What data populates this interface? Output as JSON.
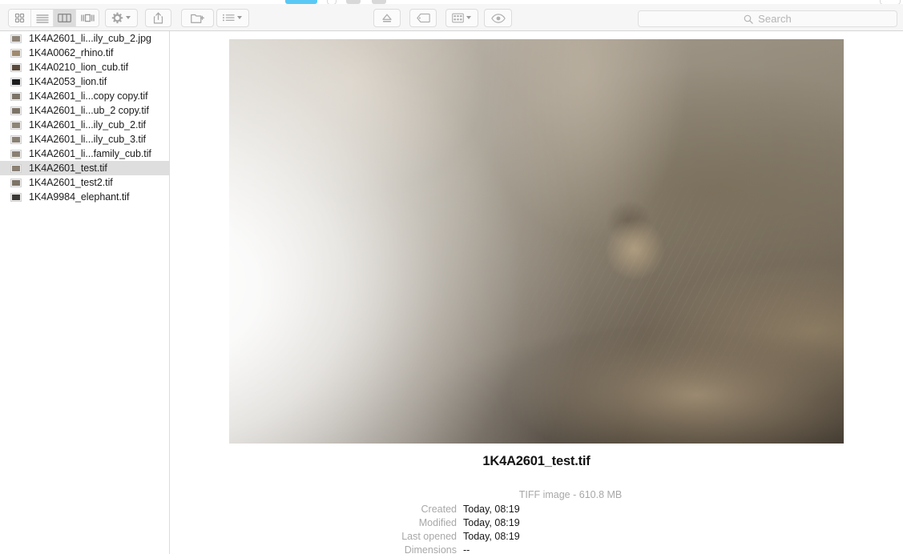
{
  "window": {
    "tabs": [
      {
        "name": "tab-active",
        "state": "active",
        "color": "#5ac8f5"
      },
      {
        "name": "tab-inactive-1",
        "state": "inactive",
        "color": "#d8d8d8"
      },
      {
        "name": "tab-inactive-2",
        "state": "inactive",
        "color": "#d8d8d8"
      },
      {
        "name": "tab-inactive-3",
        "state": "inactive",
        "color": "#d8d8d8"
      }
    ]
  },
  "toolbar": {
    "view_modes": [
      {
        "id": "icon-view",
        "icon": "grid-icon",
        "active": false
      },
      {
        "id": "list-view",
        "icon": "list-icon",
        "active": false
      },
      {
        "id": "column-view",
        "icon": "columns-icon",
        "active": true
      },
      {
        "id": "gallery-view",
        "icon": "gallery-icon",
        "active": false
      }
    ],
    "action_button": {
      "id": "action-menu",
      "icon": "gear-icon",
      "has_chevron": true
    },
    "share_button": {
      "id": "share",
      "icon": "share-icon"
    },
    "new_folder_button": {
      "id": "new-folder",
      "icon": "new-folder-icon"
    },
    "arrange_button": {
      "id": "arrange-menu",
      "icon": "arrange-list-icon",
      "has_chevron": true
    },
    "eject_button": {
      "id": "eject",
      "icon": "eject-icon"
    },
    "tag_button": {
      "id": "tag",
      "icon": "tag-icon"
    },
    "group_button": {
      "id": "group-menu",
      "icon": "group-grid-icon",
      "has_chevron": true
    },
    "quicklook_button": {
      "id": "quick-look",
      "icon": "eye-icon"
    }
  },
  "search": {
    "placeholder": "Search",
    "value": "",
    "icon": "search-icon"
  },
  "file_list": {
    "selected_index": 9,
    "items": [
      {
        "name": "1K4A2601_li...ily_cub_2.jpg",
        "thumb": "#8e8478"
      },
      {
        "name": "1K4A0062_rhino.tif",
        "thumb": "#a08a6e"
      },
      {
        "name": "1K4A0210_lion_cub.tif",
        "thumb": "#5b4a3a"
      },
      {
        "name": "1K4A2053_lion.tif",
        "thumb": "#1d1d1d"
      },
      {
        "name": "1K4A2601_li...copy copy.tif",
        "thumb": "#7d7468"
      },
      {
        "name": "1K4A2601_li...ub_2 copy.tif",
        "thumb": "#7d7468"
      },
      {
        "name": "1K4A2601_li...ily_cub_2.tif",
        "thumb": "#8e8478"
      },
      {
        "name": "1K4A2601_li...ily_cub_3.tif",
        "thumb": "#8a8074"
      },
      {
        "name": "1K4A2601_li...family_cub.tif",
        "thumb": "#8a8074"
      },
      {
        "name": "1K4A2601_test.tif",
        "thumb": "#8a8074"
      },
      {
        "name": "1K4A2601_test2.tif",
        "thumb": "#7d7468"
      },
      {
        "name": "1K4A9984_elephant.tif",
        "thumb": "#3d3a36"
      }
    ]
  },
  "preview": {
    "image_alt": "lion-cub-photo",
    "file_title": "1K4A2601_test.tif",
    "kind_and_size": "TIFF image - 610.8 MB",
    "metadata": [
      {
        "label": "Created",
        "value": "Today, 08:19"
      },
      {
        "label": "Modified",
        "value": "Today, 08:19"
      },
      {
        "label": "Last opened",
        "value": "Today, 08:19"
      },
      {
        "label": "Dimensions",
        "value": "--"
      }
    ]
  }
}
